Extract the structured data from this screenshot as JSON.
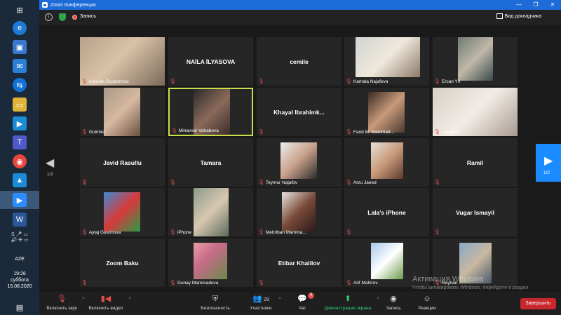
{
  "window": {
    "title": "Zoom Конференция"
  },
  "topbar": {
    "record_label": "Запись",
    "view_label": "Вид докладчика"
  },
  "taskbar": {
    "language": "AZE",
    "time": "19:26",
    "day": "суббота",
    "date": "15.08.2020"
  },
  "gallery": {
    "page_left": "1/2",
    "page_right": "1/2",
    "tiles": [
      {
        "name": "Kamala Rustamova",
        "video": true,
        "center": ""
      },
      {
        "name": "",
        "video": false,
        "center": "NAİLA İLYASOVA"
      },
      {
        "name": "",
        "video": false,
        "center": "cemile"
      },
      {
        "name": "Kamala Najafova",
        "video": true,
        "center": ""
      },
      {
        "name": "Ercan Yıl",
        "video": true,
        "center": ""
      },
      {
        "name": "Gulmire",
        "video": true,
        "center": ""
      },
      {
        "name": "Minavvar Vahabova",
        "video": true,
        "center": "",
        "active": true
      },
      {
        "name": "",
        "video": false,
        "center": "Khayal  Ibrahimk..."
      },
      {
        "name": "Farid M. Mammad...",
        "video": true,
        "center": ""
      },
      {
        "name": "Asmar H",
        "video": true,
        "center": ""
      },
      {
        "name": "",
        "video": false,
        "center": "Javid Rasullu"
      },
      {
        "name": "",
        "video": false,
        "center": "Tamara"
      },
      {
        "name": "Teymur Najafov",
        "video": true,
        "center": ""
      },
      {
        "name": "Arzu Jaeed",
        "video": true,
        "center": ""
      },
      {
        "name": "",
        "video": false,
        "center": "Ramil"
      },
      {
        "name": "Aytaj Gasimova",
        "video": true,
        "center": ""
      },
      {
        "name": "iPhone",
        "video": true,
        "center": ""
      },
      {
        "name": "Mehriban Mamma...",
        "video": true,
        "center": ""
      },
      {
        "name": "",
        "video": false,
        "center": "Lala's iPhone"
      },
      {
        "name": "",
        "video": false,
        "center": "Vugar Ismayil"
      },
      {
        "name": "",
        "video": false,
        "center": "Zoom Baku"
      },
      {
        "name": "Gunay Mammadova",
        "video": true,
        "center": ""
      },
      {
        "name": "",
        "video": false,
        "center": "Etibar Khalilov"
      },
      {
        "name": "Arif Mahirov",
        "video": true,
        "center": ""
      },
      {
        "name": "Reyhan",
        "video": true,
        "center": ""
      }
    ]
  },
  "watermark": {
    "line1": "Активация Windows",
    "line2": "Чтобы активировать Windows, перейдите в раздел \"Параметры\"."
  },
  "toolbar": {
    "mute": "Включить звук",
    "video": "Включить видео",
    "security": "Безопасность",
    "participants": "Участники",
    "participants_count": "29",
    "chat": "Чат",
    "chat_badge": "4",
    "share": "Демонстрация экрана",
    "record": "Запись",
    "reactions": "Реакции",
    "end": "Завершить"
  },
  "colors": {
    "title_bar": "#1d6bd8",
    "active_speaker": "#c8e04a",
    "muted_icon": "#e34d4d",
    "share": "#2ed47a",
    "end_button": "#c8272d",
    "nav_button": "#1a8cff"
  }
}
